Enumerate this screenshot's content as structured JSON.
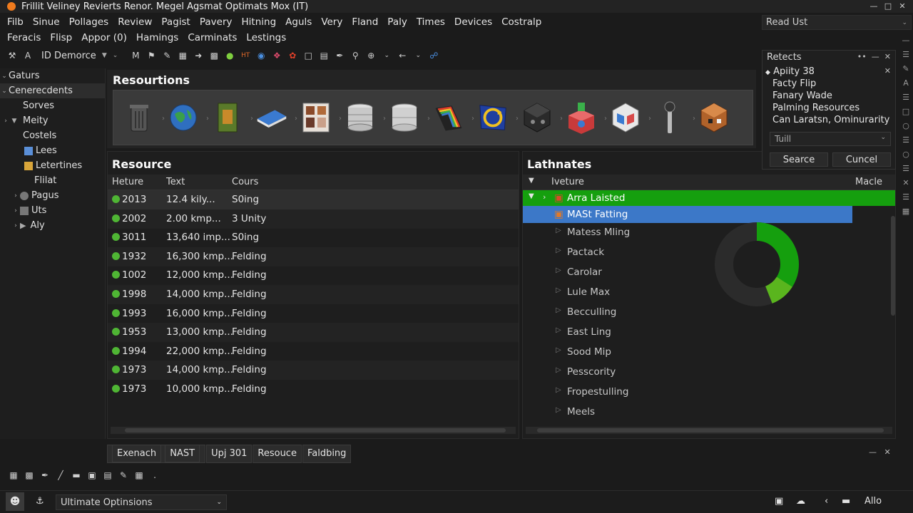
{
  "window": {
    "title": "Frillit  Veliney  Revierts  Renor.  Megel  Agsmat  Optimats  Mox (IT)"
  },
  "menu1": [
    "Filb",
    "Sinue",
    "Pollages",
    "Review",
    "Pagist",
    "Pavery",
    "Hitning",
    "Aguls",
    "Very",
    "Fland",
    "Paly",
    "Times",
    "Devices",
    "Costralp"
  ],
  "read_box": "Read Ust",
  "menu2": [
    "Feracis",
    "Flisp",
    "Appor (0)",
    "Hamings",
    "Carminats",
    "Lestings"
  ],
  "toolbar": {
    "doc_select": "ID Demorce"
  },
  "sidebar": {
    "items": [
      {
        "label": "Gaturs"
      },
      {
        "label": "Cenerecdents"
      },
      {
        "label": "Sorves"
      },
      {
        "label": "Meity"
      },
      {
        "label": "Costels"
      },
      {
        "label": "Lees"
      },
      {
        "label": "Letertines"
      },
      {
        "label": "Flilat"
      },
      {
        "label": "Pagus"
      },
      {
        "label": "Uts"
      },
      {
        "label": "Aly"
      }
    ]
  },
  "resources": {
    "title": "Resourtions"
  },
  "resource_table": {
    "title": "Resource",
    "columns": [
      "Heture",
      "Text",
      "Cours"
    ],
    "rows": [
      {
        "year": "2013",
        "text": "12.4 kily...",
        "cours": "S0ing"
      },
      {
        "year": "2002",
        "text": "2.00 kmp...",
        "cours": "3 Unity"
      },
      {
        "year": "3011",
        "text": "13,640 imp...",
        "cours": "S0ing"
      },
      {
        "year": "1932",
        "text": "16,300 kmp...",
        "cours": "Felding"
      },
      {
        "year": "1002",
        "text": "12,000 kmp...",
        "cours": "Felding"
      },
      {
        "year": "1998",
        "text": "14,000 kmp...",
        "cours": "Felding"
      },
      {
        "year": "1993",
        "text": "16,000 kmp...",
        "cours": "Felding"
      },
      {
        "year": "1953",
        "text": "13,000 kmp...",
        "cours": "Felding"
      },
      {
        "year": "1994",
        "text": "22,000 kmp...",
        "cours": "Felding"
      },
      {
        "year": "1973",
        "text": "14,000 kmp...",
        "cours": "Felding"
      },
      {
        "year": "1973",
        "text": "10,000 kmp...",
        "cours": "Felding"
      }
    ]
  },
  "lath_table": {
    "title": "Lathnates",
    "columns": [
      "Iveture",
      "Macle"
    ],
    "rows": [
      "Arra Laisted",
      "MASt Fatting",
      "Matess Mling",
      "Pactack",
      "Carolar",
      "Lule Max",
      "Becculling",
      "East Ling",
      "Sood Mip",
      "Pesscority",
      "Fropestulling",
      "Meels"
    ],
    "donut": {
      "green_fraction": 0.34,
      "lightgreen_fraction": 0.1
    }
  },
  "dialog": {
    "title": "Retects",
    "items": [
      "Apiity 38",
      "Facty Flip",
      "Fanary Wade",
      "Palming Resources",
      "Can Laratsn, Ominurarity"
    ],
    "select": "Tuill",
    "search": "Searce",
    "cancel": "Cuncel"
  },
  "bottom_tabs": [
    "Exenach",
    "NAST",
    "Upj 301",
    "Resouce",
    "Faldbing"
  ],
  "status": {
    "select": "Ultimate Optinsions",
    "right": "Allo"
  },
  "colors": {
    "accent_green": "#159f0e",
    "selection_blue": "#3c78c8",
    "dot_green": "#4fb534"
  }
}
